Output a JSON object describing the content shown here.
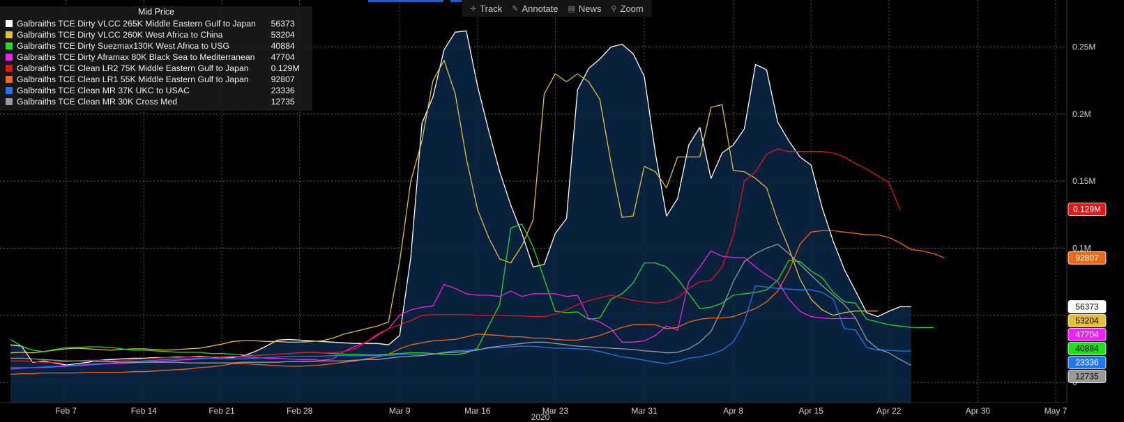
{
  "toolbar": {
    "track_label": "Track",
    "annotate_label": "Annotate",
    "news_label": "News",
    "zoom_label": "Zoom"
  },
  "legend": {
    "title": "Mid Price",
    "items": [
      {
        "name": "Galbraiths TCE Dirty VLCC 265K Middle Eastern Gulf to Japan",
        "value": "56373",
        "color": "#ffffff"
      },
      {
        "name": "Galbraiths TCE Dirty VLCC 260K West Africa to China",
        "value": "53204",
        "color": "#e3c03c"
      },
      {
        "name": "Galbraiths TCE Dirty Suezmax130K West Africa to USG",
        "value": "40884",
        "color": "#22dd22"
      },
      {
        "name": "Galbraiths TCE Dirty Aframax 80K Black Sea to Mediterranean",
        "value": "47704",
        "color": "#ee22ee"
      },
      {
        "name": "Galbraiths TCE Clean LR2 75K Middle Eastern Gulf to Japan",
        "value": "0.129M",
        "color": "#e01818"
      },
      {
        "name": "Galbraiths TCE Clean LR1 55K Middle Eastern Gulf to Japan",
        "value": "92807",
        "color": "#ee6a14"
      },
      {
        "name": "Galbraiths TCE Clean MR 37K UKC to USAC",
        "value": "23336",
        "color": "#2277ee"
      },
      {
        "name": "Galbraiths TCE Clean MR 30K Cross Med",
        "value": "12735",
        "color": "#9a9a9a"
      }
    ]
  },
  "chart_data": {
    "type": "line",
    "title": "",
    "xlabel": "2020",
    "ylabel": "",
    "ylim": [
      -15000,
      285000
    ],
    "y_ticks": [
      0,
      50000,
      100000,
      150000,
      200000,
      250000
    ],
    "y_tick_labels": [
      "0",
      "",
      "0.1M",
      "0.15M",
      "0.2M",
      "0.25M"
    ],
    "x_tick_labels": [
      "Feb 7",
      "Feb 14",
      "Feb 21",
      "Feb 28",
      "Mar 9",
      "Mar 16",
      "Mar 23",
      "Mar 31",
      "Apr 8",
      "Apr 15",
      "Apr 22",
      "Apr 30",
      "May 7"
    ],
    "x_tick_index": [
      5,
      12,
      19,
      26,
      35,
      42,
      49,
      57,
      65,
      72,
      79,
      87,
      94
    ],
    "x_year_label": "2020",
    "grid": true,
    "legend_position": "top-left",
    "area_series_index": 0,
    "n_points": 96,
    "series": [
      {
        "name": "Galbraiths TCE Dirty VLCC 265K Middle Eastern Gulf to Japan",
        "color": "#ffffff",
        "last_label": "56373",
        "values": [
          28000,
          27000,
          15000,
          16000,
          14500,
          13000,
          14000,
          15000,
          16500,
          17000,
          17500,
          18000,
          18000,
          18500,
          18500,
          19000,
          19000,
          19500,
          19000,
          18500,
          18500,
          20000,
          23000,
          27000,
          31500,
          32000,
          31500,
          31000,
          30500,
          30000,
          29500,
          29000,
          29000,
          29000,
          28000,
          35000,
          93000,
          193000,
          213000,
          248000,
          261000,
          262000,
          221000,
          188000,
          157000,
          132000,
          111000,
          86000,
          88000,
          111000,
          122000,
          218000,
          234000,
          241000,
          250000,
          252000,
          245000,
          228000,
          171000,
          124000,
          137000,
          177000,
          190000,
          152000,
          171000,
          177000,
          189000,
          237000,
          233000,
          194000,
          180000,
          168000,
          162000,
          130000,
          105000,
          84000,
          68000,
          52000,
          49000,
          53000,
          56373,
          56373
        ]
      },
      {
        "name": "Galbraiths TCE Dirty VLCC 260K West Africa to China",
        "color": "#e3c03c",
        "last_label": "53204",
        "values": [
          22000,
          22500,
          22000,
          23000,
          24000,
          25000,
          25500,
          25000,
          24500,
          24000,
          24500,
          25000,
          25000,
          24500,
          24000,
          24500,
          25000,
          25500,
          27000,
          28500,
          30500,
          31000,
          31000,
          30500,
          30500,
          30000,
          30000,
          30500,
          31000,
          33000,
          36000,
          38000,
          40000,
          42000,
          45000,
          90000,
          150000,
          180000,
          225000,
          240000,
          215000,
          167000,
          129000,
          108000,
          92000,
          89000,
          102000,
          121000,
          215000,
          230000,
          224000,
          230000,
          224000,
          211000,
          164000,
          123000,
          124000,
          161000,
          157000,
          145000,
          168000,
          168000,
          168000,
          205000,
          207000,
          158000,
          157000,
          152000,
          145000,
          120000,
          100000,
          77000,
          62000,
          54000,
          50000,
          52000,
          53204,
          53204,
          53204
        ]
      },
      {
        "name": "Galbraiths TCE Dirty Suezmax130K West Africa to USG",
        "color": "#22dd22",
        "last_label": "40884",
        "values": [
          32000,
          27000,
          24000,
          23000,
          24500,
          26000,
          26000,
          26500,
          26500,
          26000,
          25000,
          24000,
          24000,
          23500,
          23000,
          22500,
          22500,
          22500,
          21500,
          21500,
          21000,
          20500,
          20000,
          20500,
          21000,
          21500,
          22000,
          22500,
          22000,
          21500,
          21000,
          21000,
          20500,
          20500,
          21000,
          21500,
          22000,
          22000,
          21500,
          21000,
          20500,
          22000,
          25500,
          42000,
          58000,
          115000,
          118000,
          101000,
          77000,
          53000,
          52000,
          52500,
          47000,
          48000,
          62000,
          66000,
          74000,
          89000,
          89000,
          86000,
          77000,
          66000,
          55000,
          56000,
          59000,
          65000,
          66000,
          67000,
          69000,
          76000,
          91000,
          90000,
          83000,
          78000,
          67000,
          60000,
          59000,
          47000,
          45000,
          43000,
          42000,
          41000,
          40884,
          40884
        ]
      },
      {
        "name": "Galbraiths TCE Dirty Aframax 80K Black Sea to Mediterranean",
        "color": "#ee22ee",
        "last_label": "47704",
        "values": [
          10000,
          10500,
          11000,
          11000,
          11500,
          12000,
          12500,
          13000,
          13500,
          14000,
          14000,
          14500,
          15000,
          15500,
          16000,
          16500,
          17000,
          17500,
          18000,
          18500,
          19000,
          19000,
          18500,
          18000,
          18000,
          17500,
          17000,
          17000,
          16500,
          17500,
          23000,
          27000,
          30000,
          35000,
          40000,
          50000,
          54000,
          56000,
          57000,
          73000,
          70000,
          66000,
          65000,
          65000,
          64000,
          68000,
          64000,
          66000,
          66000,
          66000,
          64000,
          65000,
          48000,
          45000,
          40000,
          30000,
          30000,
          31000,
          35000,
          42000,
          39000,
          75000,
          86000,
          98000,
          94000,
          93000,
          93000,
          86000,
          80000,
          75000,
          62000,
          53000,
          49000,
          48000,
          47500,
          47704,
          47704
        ]
      },
      {
        "name": "Galbraiths TCE Clean LR2 75K Middle Eastern Gulf to Japan",
        "color": "#e01818",
        "last_label": "0.129M",
        "values": [
          16000,
          16000,
          15500,
          15000,
          15000,
          15500,
          16000,
          16500,
          16500,
          16000,
          16000,
          17000,
          17500,
          18000,
          18500,
          18500,
          19000,
          19000,
          19000,
          19000,
          19500,
          19500,
          20000,
          20500,
          21000,
          21500,
          22000,
          22500,
          22000,
          22000,
          23000,
          25000,
          30000,
          36000,
          40000,
          43000,
          46000,
          50000,
          50500,
          50500,
          50500,
          50500,
          50000,
          50000,
          50000,
          49500,
          49500,
          49000,
          49000,
          51000,
          54000,
          58000,
          61000,
          63000,
          65000,
          63000,
          61000,
          60000,
          59000,
          60000,
          63000,
          70000,
          75000,
          76000,
          86000,
          109000,
          150000,
          157000,
          170000,
          174000,
          172000,
          172000,
          172000,
          172000,
          171000,
          168000,
          163000,
          159000,
          154000,
          149000,
          129000
        ]
      },
      {
        "name": "Galbraiths TCE Clean LR1 55K Middle Eastern Gulf to Japan",
        "color": "#ee6a14",
        "last_label": "92807",
        "values": [
          6000,
          6500,
          6500,
          7000,
          7000,
          7000,
          7000,
          7500,
          7500,
          7500,
          7500,
          8000,
          8000,
          8500,
          9000,
          9500,
          10000,
          11000,
          11500,
          12500,
          14000,
          14000,
          13500,
          13000,
          12500,
          12000,
          12000,
          12500,
          13000,
          14000,
          15000,
          16000,
          17500,
          19000,
          21000,
          25000,
          28000,
          29500,
          31000,
          31500,
          32000,
          34000,
          36000,
          35500,
          35000,
          34000,
          34000,
          33000,
          33000,
          32000,
          31500,
          31500,
          33000,
          35000,
          38000,
          41000,
          43000,
          43000,
          43000,
          40000,
          41000,
          45000,
          47000,
          48000,
          48000,
          49000,
          52000,
          55000,
          60000,
          68000,
          83000,
          103000,
          112000,
          113000,
          113000,
          112000,
          111000,
          110000,
          110000,
          108000,
          104000,
          99000,
          98000,
          96000,
          92807
        ]
      },
      {
        "name": "Galbraiths TCE Clean MR 37K UKC to USAC",
        "color": "#2277ee",
        "last_label": "23336",
        "values": [
          11000,
          11000,
          11000,
          11500,
          12000,
          12500,
          13000,
          13500,
          14000,
          14500,
          15000,
          15500,
          16000,
          16500,
          17000,
          17500,
          17500,
          18000,
          18000,
          17500,
          17500,
          17500,
          18000,
          18500,
          19000,
          19500,
          19500,
          19500,
          19500,
          20000,
          20000,
          20000,
          20000,
          20000,
          20000,
          21000,
          20500,
          20500,
          21000,
          22500,
          23500,
          24000,
          24500,
          25500,
          26000,
          26500,
          27000,
          27000,
          26000,
          25500,
          25500,
          25000,
          24500,
          23000,
          21000,
          19000,
          18000,
          16500,
          15000,
          14000,
          15500,
          18000,
          19000,
          21000,
          24000,
          30000,
          45000,
          72000,
          71000,
          70000,
          69500,
          69000,
          69000,
          67000,
          62000,
          40000,
          39000,
          26000,
          24000,
          24000,
          23336,
          23336
        ]
      },
      {
        "name": "Galbraiths TCE Clean MR 30K Cross Med",
        "color": "#9a9a9a",
        "last_label": "12735",
        "values": [
          18000,
          18000,
          17500,
          17000,
          16500,
          16000,
          16000,
          16000,
          15500,
          15500,
          15000,
          15000,
          15000,
          15000,
          15000,
          15000,
          14500,
          14500,
          14500,
          14500,
          14500,
          15000,
          15000,
          15000,
          15000,
          15500,
          15500,
          15500,
          16000,
          16000,
          16000,
          16500,
          17000,
          17000,
          18000,
          19000,
          19500,
          20000,
          21000,
          22000,
          22500,
          23000,
          24000,
          26000,
          27000,
          28000,
          29000,
          30000,
          30000,
          29000,
          28000,
          27000,
          26500,
          26000,
          25500,
          25000,
          24500,
          23500,
          23000,
          22000,
          22500,
          25000,
          30000,
          38000,
          55000,
          75000,
          90000,
          96000,
          100000,
          103000,
          96000,
          88000,
          80000,
          72000,
          65000,
          58000,
          48000,
          32000,
          25000,
          22000,
          17000,
          12735
        ]
      }
    ]
  }
}
